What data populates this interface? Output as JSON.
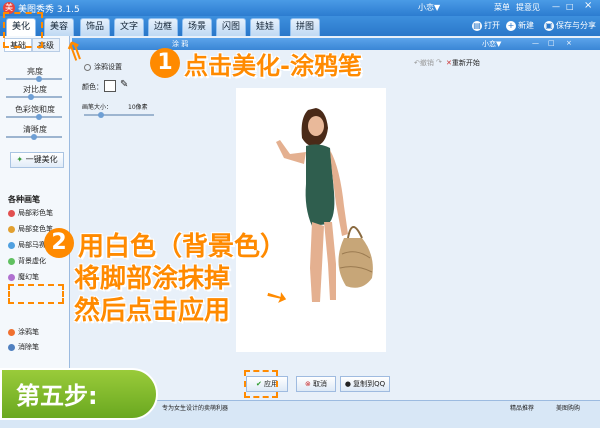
{
  "app": {
    "title": "美图秀秀 3.1.5",
    "logo": "美"
  },
  "titlebar": {
    "user": "小恋▼",
    "menu": "菜单",
    "feedback": "提意见",
    "min": "—",
    "max": "□",
    "close": "×"
  },
  "tabs": [
    "美化",
    "美容",
    "饰品",
    "文字",
    "边框",
    "场景",
    "闪图",
    "娃娃",
    "拼图"
  ],
  "toolbar": {
    "open": "打开",
    "new": "新建",
    "save": "保存与分享"
  },
  "left": {
    "subtabs": [
      "基础",
      "高级"
    ],
    "sliders": [
      "亮度",
      "对比度",
      "色彩饱和度",
      "清晰度"
    ],
    "slider_levels": [
      0.55,
      0.4,
      0.55,
      0.45
    ],
    "one_key": "一键美化",
    "section": "各种画笔",
    "brushes": [
      "局部彩色笔",
      "局部变色笔",
      "局部马赛克",
      "背景虚化",
      "魔幻笔",
      "涂鸦笔",
      "消除笔"
    ]
  },
  "window": {
    "title": "涂 鸦",
    "user": "小恋▼",
    "undo": "撤销",
    "redo": "重做",
    "restart": "重新开始"
  },
  "settings": {
    "title": "涂鸦设置",
    "color": "颜色：",
    "size": "画笔大小：",
    "size_value": "10像素"
  },
  "actions": {
    "apply": "应用",
    "cancel": "取消",
    "copy": "复制到QQ"
  },
  "status": {
    "left": "专为女生设计的卖萌利器",
    "link1": "精品推荐",
    "link2": "美图购购"
  },
  "annotations": {
    "n1": "1",
    "a1": "点击美化-涂鸦笔",
    "n2": "2",
    "a2_line1": "用白色（背景色）",
    "a2_line2": "将脚部涂抹掉",
    "a2_line3": "然后点击应用",
    "step": "第五步:"
  },
  "colors": {
    "accent": "#ff8a00",
    "titlebar": "#2c7cd0",
    "step_green": "#7cb82a",
    "swimsuit": "#2f5e4e"
  }
}
